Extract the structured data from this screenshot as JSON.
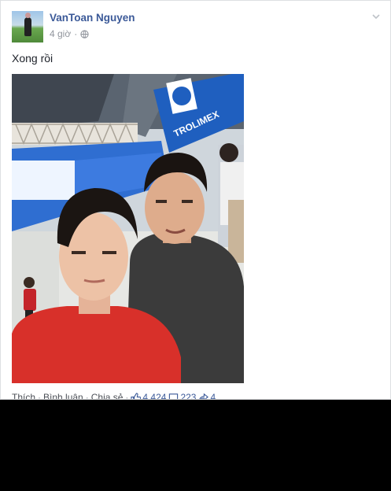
{
  "post": {
    "author": "VanToan Nguyen",
    "time": "4 giờ",
    "message": "Xong rồi",
    "photo_alt": ""
  },
  "actions": {
    "like": "Thích",
    "comment": "Bình luận",
    "share": "Chia sẻ",
    "separator": "·",
    "like_count": "4.424",
    "comment_count": "223",
    "share_count": "4"
  },
  "icons": {
    "audience": "globe-icon",
    "menu": "chevron-down-icon",
    "like_stat": "thumbs-up-icon",
    "comment_stat": "comment-icon",
    "share_stat": "share-icon"
  },
  "colors": {
    "name": "#3b5998",
    "meta": "#90949c",
    "border": "#dddfe2",
    "shirt_red": "#d8302a",
    "shirt_gray": "#3b3b3b",
    "banner_blue": "#1f5fbf"
  }
}
